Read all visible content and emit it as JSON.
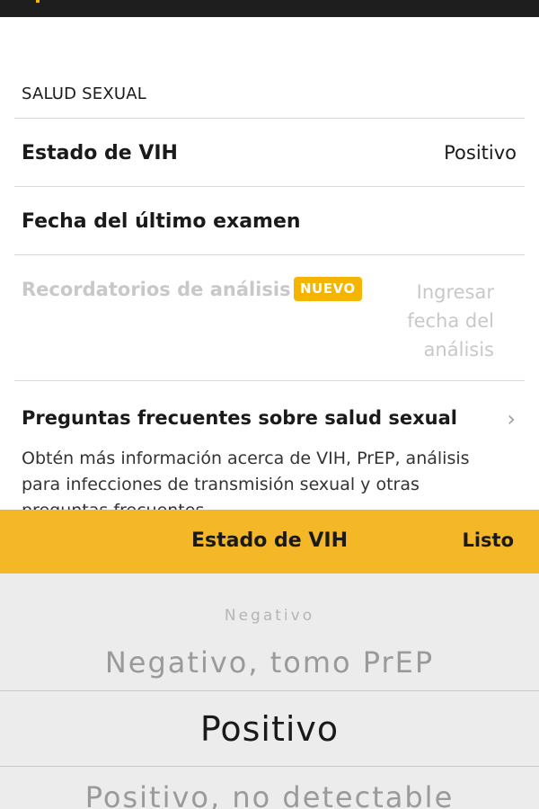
{
  "section": {
    "header": "SALUD SEXUAL"
  },
  "rows": {
    "hiv_status": {
      "label": "Estado de VIH",
      "value": "Positivo"
    },
    "last_test": {
      "label": "Fecha del último examen"
    },
    "reminders": {
      "label": "Recordatorios de análisis",
      "badge": "NUEVO",
      "value": "Ingresar fecha del análisis"
    }
  },
  "faq": {
    "title": "Preguntas frecuentes sobre salud sexual",
    "description": "Obtén más información acerca de VIH, PrEP, análisis para infecciones de transmisión sexual y otras preguntas frecuentes",
    "icon": "chevron-right-icon"
  },
  "picker": {
    "title": "Estado de VIH",
    "done_label": "Listo",
    "selected": "Positivo",
    "options": [
      "Negativo",
      "Negativo, tomo PrEP",
      "Positivo",
      "Positivo, no detectable"
    ]
  },
  "colors": {
    "accent": "#f4b728",
    "badge": "#f4b400",
    "disabled_text": "#c8c8c8",
    "picker_bg": "#ececec"
  }
}
